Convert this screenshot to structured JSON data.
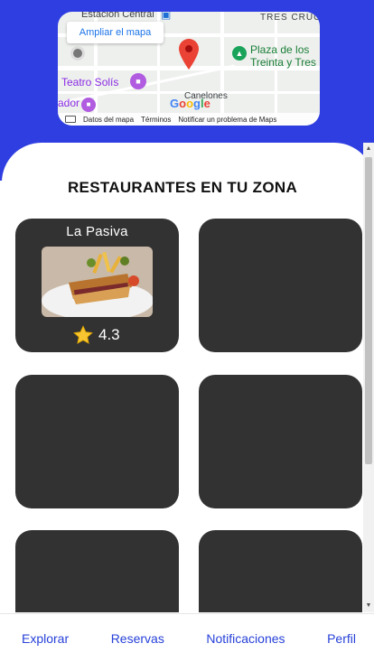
{
  "map": {
    "expand_label": "Ampliar el mapa",
    "labels": {
      "estacion_central": "Estación Central",
      "tres_cruces": "TRES CRUC",
      "plaza": "Plaza de los",
      "plaza2": "Treinta y Tres",
      "teatro": "Teatro Solís",
      "ador": "ador",
      "canelones": "Canelones",
      "google": "Google"
    },
    "footer": {
      "datos": "Datos del mapa",
      "terminos": "Términos",
      "reportar": "Notificar un problema de Maps"
    }
  },
  "section_title": "RESTAURANTES EN TU ZONA",
  "restaurants": [
    {
      "name": "La Pasiva",
      "rating": "4.3"
    }
  ],
  "nav": {
    "explorar": "Explorar",
    "reservas": "Reservas",
    "notificaciones": "Notificaciones",
    "perfil": "Perfil"
  },
  "colors": {
    "accent": "#2f3ee0",
    "card": "#323232",
    "nav_text": "#2741d8"
  }
}
